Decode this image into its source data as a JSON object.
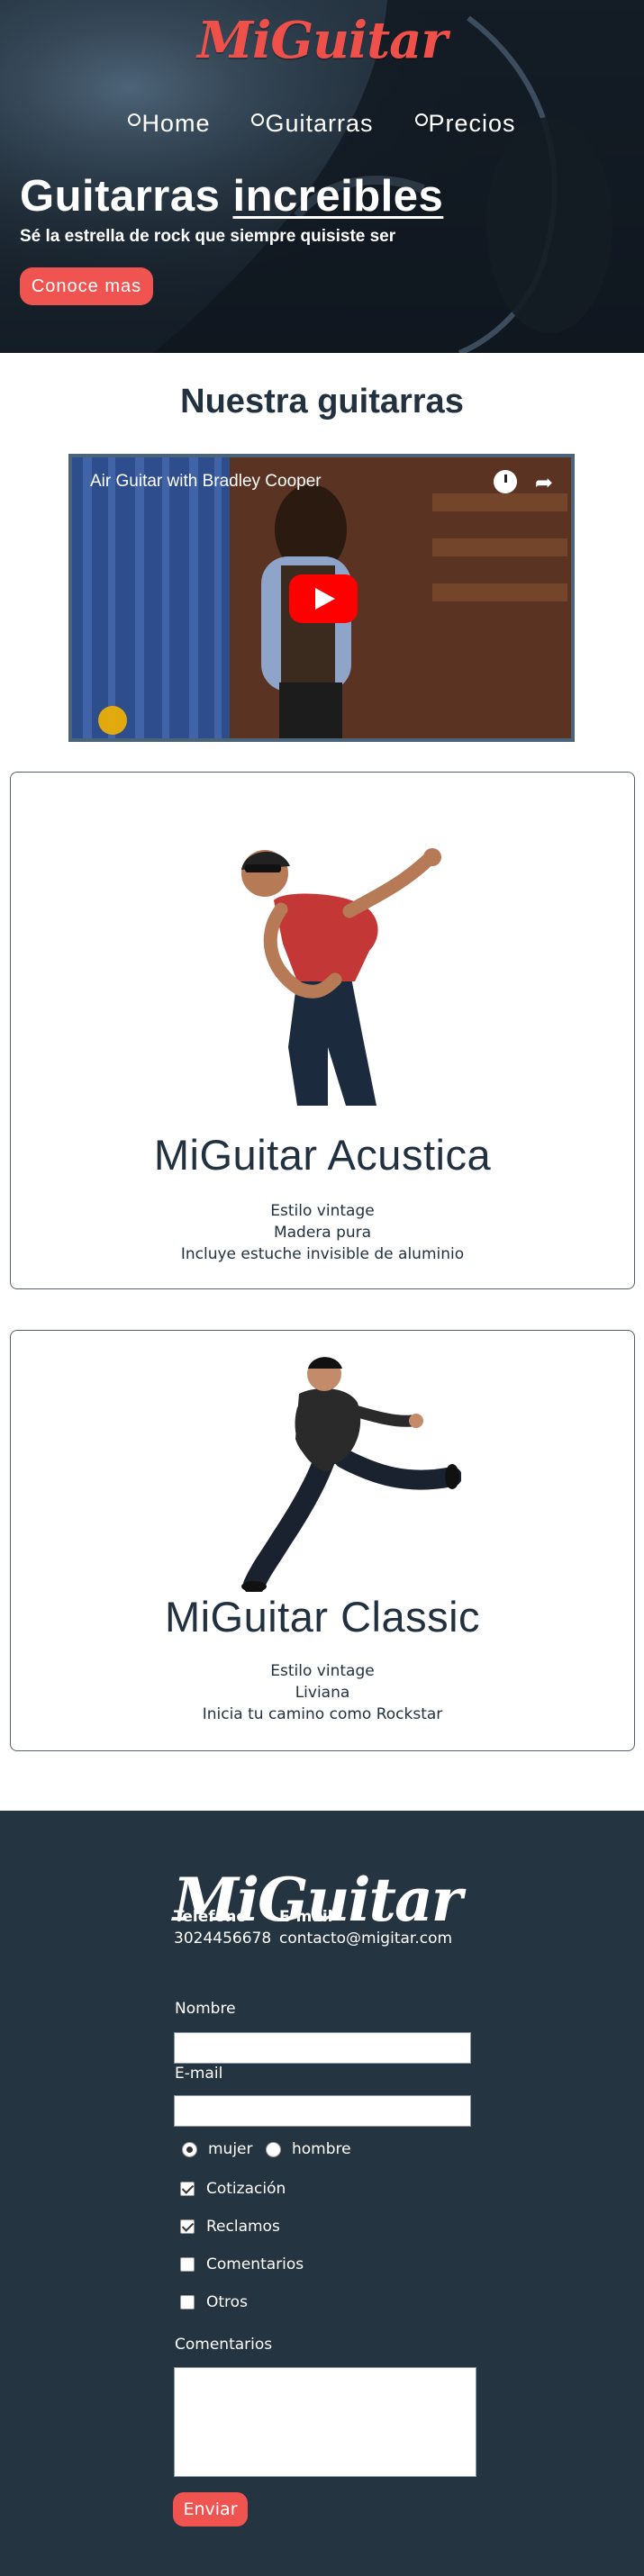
{
  "header": {
    "brand": "MiGuitar",
    "nav": [
      "Home",
      "Guitarras",
      "Precios"
    ],
    "headline_part1": "Guitarras ",
    "headline_part2": "increibles",
    "subtitle": "Sé la estrella de rock que siempre quisiste ser",
    "cta": "Conoce mas"
  },
  "section": {
    "title": "Nuestra guitarras"
  },
  "video": {
    "title": "Air Guitar with Bradley Cooper"
  },
  "products": [
    {
      "name": "MiGuitar Acustica",
      "features": [
        "Estilo vintage",
        "Madera pura",
        "Incluye estuche invisible de aluminio"
      ]
    },
    {
      "name": "MiGuitar Classic",
      "features": [
        "Estilo vintage",
        "Liviana",
        "Inicia tu camino como Rockstar"
      ]
    }
  ],
  "footer": {
    "brand": "MiGuitar",
    "phone_label": "Telefono",
    "phone": "3024456678",
    "email_label": "E-mail",
    "email": "contacto@migitar.com",
    "form": {
      "name_label": "Nombre",
      "email_label": "E-mail",
      "gender": [
        "mujer",
        "hombre"
      ],
      "checkboxes": [
        "Cotización",
        "Reclamos",
        "Comentarios",
        "Otros"
      ],
      "comments_label": "Comentarios",
      "submit": "Enviar"
    }
  },
  "colors": {
    "accent": "#ef5450",
    "dark": "#253441",
    "text": "#22313f"
  }
}
